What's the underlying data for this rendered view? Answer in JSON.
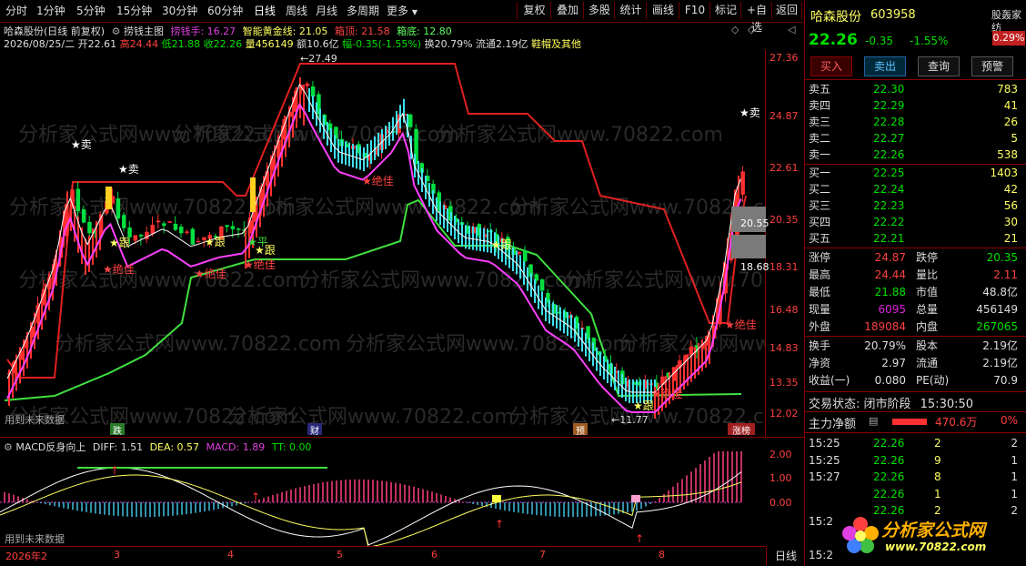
{
  "toolbar": {
    "periods": [
      "分时",
      "1分钟",
      "5分钟",
      "15分钟",
      "30分钟",
      "60分钟",
      "日线",
      "周线",
      "月线",
      "多周期",
      "更多"
    ],
    "active_period": "日线",
    "tools": [
      "复权",
      "叠加",
      "多股",
      "统计",
      "画线",
      "F10",
      "标记",
      "+自选",
      "返回"
    ]
  },
  "stock": {
    "name": "哈森股份",
    "code": "603958",
    "price": "22.26",
    "change": "-0.35",
    "change_pct": "-1.55%",
    "badge": "股轰家纺",
    "badge_pct": "0.29%"
  },
  "chart_header": {
    "title": "哈森股份(日线 前复权)",
    "indicator": "捞钱主图",
    "ind_vals": [
      "捞钱手: 16.27",
      "智能黄金线: 21.05",
      "箱顶: 21.58",
      "箱底: 12.80"
    ],
    "date": "2026/08/25/二",
    "open": "开22.61",
    "high": "高24.44",
    "low": "低21.88",
    "close": "收22.26",
    "volume": "量456149",
    "amount": "额10.6亿",
    "amp": "幅-0.35(-1.55%)",
    "turnover": "换20.79%",
    "float": "流通2.19亿",
    "sector": "鞋帽及其他"
  },
  "price_axis": [
    "27.36",
    "24.87",
    "22.61",
    "20.35",
    "18.31",
    "16.48",
    "14.83",
    "13.35",
    "12.02"
  ],
  "price_markers": [
    "20.55",
    "18.68"
  ],
  "price_annotations": {
    "high": "27.49",
    "low": "11.77"
  },
  "signals": {
    "sell": "卖",
    "follow": "跟",
    "best": "绝佳",
    "follow_stop": "平"
  },
  "future_label": "用到未来数据",
  "markers_row": [
    "跌",
    "财",
    "预",
    "涨榜"
  ],
  "watermark": "分析家公式网www.70822.com",
  "macd": {
    "label": "MACD反身向上",
    "diff": "DIFF: 1.51",
    "dea": "DEA: 0.57",
    "macd": "MACD: 1.89",
    "tt": "TT: 0.00",
    "axis": [
      "2.00",
      "1.00",
      "0.00"
    ]
  },
  "x_axis": [
    "2026年2",
    "3",
    "4",
    "5",
    "6",
    "7",
    "8"
  ],
  "period_label": "日线",
  "buttons": [
    "买入",
    "卖出",
    "查询",
    "预警"
  ],
  "asks": [
    {
      "label": "卖五",
      "price": "22.30",
      "vol": "783"
    },
    {
      "label": "卖四",
      "price": "22.29",
      "vol": "41"
    },
    {
      "label": "卖三",
      "price": "22.28",
      "vol": "26"
    },
    {
      "label": "卖二",
      "price": "22.27",
      "vol": "5"
    },
    {
      "label": "卖一",
      "price": "22.26",
      "vol": "538"
    }
  ],
  "bids": [
    {
      "label": "买一",
      "price": "22.25",
      "vol": "1403"
    },
    {
      "label": "买二",
      "price": "22.24",
      "vol": "42"
    },
    {
      "label": "买三",
      "price": "22.23",
      "vol": "56"
    },
    {
      "label": "买四",
      "price": "22.22",
      "vol": "30"
    },
    {
      "label": "买五",
      "price": "22.21",
      "vol": "21"
    }
  ],
  "stats": [
    {
      "l1": "涨停",
      "v1": "24.87",
      "c1": "#ff4040",
      "l2": "跌停",
      "v2": "20.35",
      "c2": "#00e000"
    },
    {
      "l1": "最高",
      "v1": "24.44",
      "c1": "#ff4040",
      "l2": "量比",
      "v2": "2.11",
      "c2": "#ff4040"
    },
    {
      "l1": "最低",
      "v1": "21.88",
      "c1": "#00e000",
      "l2": "市值",
      "v2": "48.8亿",
      "c2": "#ddd"
    },
    {
      "l1": "现量",
      "v1": "6095",
      "c1": "#e020e0",
      "l2": "总量",
      "v2": "456149",
      "c2": "#ddd"
    },
    {
      "l1": "外盘",
      "v1": "189084",
      "c1": "#ff4040",
      "l2": "内盘",
      "v2": "267065",
      "c2": "#00e000"
    }
  ],
  "stats2": [
    {
      "l1": "换手",
      "v1": "20.79%",
      "l2": "股本",
      "v2": "2.19亿"
    },
    {
      "l1": "净资",
      "v1": "2.97",
      "l2": "流通",
      "v2": "2.19亿"
    },
    {
      "l1": "收益(一)",
      "v1": "0.080",
      "l2": "PE(动)",
      "v2": "70.9"
    }
  ],
  "status": {
    "label": "交易状态: 闭市阶段",
    "time": "15:30:50"
  },
  "main_net": {
    "label": "主力净额",
    "value": "470.6万",
    "pct": "0%"
  },
  "ticks": [
    {
      "t": "15:25",
      "p": "22.26",
      "v": "2",
      "n": "2"
    },
    {
      "t": "15:25",
      "p": "22.26",
      "v": "9",
      "n": "1"
    },
    {
      "t": "15:27",
      "p": "22.26",
      "v": "8",
      "n": "1"
    },
    {
      "t": "",
      "p": "22.26",
      "v": "1",
      "n": "1"
    },
    {
      "t": "",
      "p": "22.26",
      "v": "2",
      "n": "2"
    }
  ],
  "ticks_tail": [
    "15:2",
    "15:2"
  ],
  "logo": {
    "name": "分析家公式网",
    "url": "www.70822.com"
  }
}
